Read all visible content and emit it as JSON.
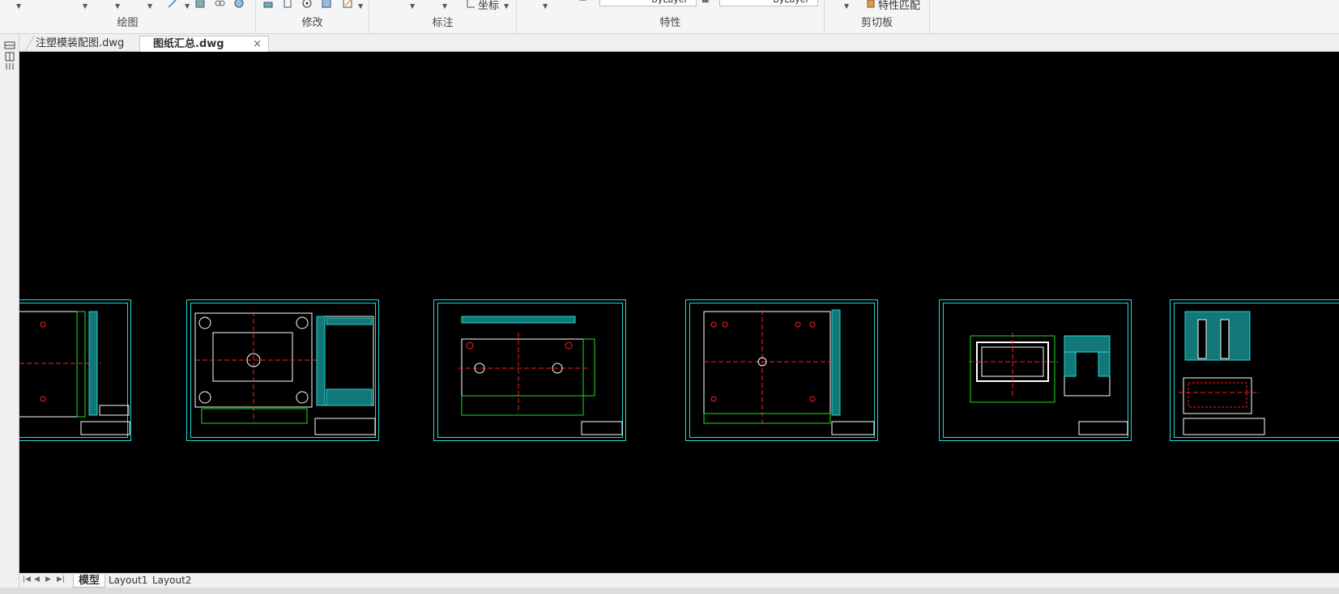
{
  "ribbon": {
    "groups": [
      {
        "label": "绘图"
      },
      {
        "label": "修改"
      },
      {
        "label": "标注"
      },
      {
        "label": "特性"
      },
      {
        "label": "剪切板"
      }
    ],
    "coordinate_label": "坐标",
    "bylayer_1": "ByLayer",
    "bylayer_2": "ByLayer",
    "match_properties": "特性匹配"
  },
  "tabs": {
    "inactive": "注塑模装配图.dwg",
    "active": "图纸汇总.dwg",
    "close": "×"
  },
  "layout_tabs": [
    "模型",
    "Layout1",
    "Layout2"
  ],
  "colors": {
    "canvas_bg": "#000000",
    "frame": "#29d6d6",
    "centerline": "#ff2020",
    "outline": "#ffffff",
    "dim": "#22dd22",
    "text": "#ffff00"
  },
  "icons": [
    "line-icon",
    "rectangle-icon",
    "region-icon",
    "circle-icon",
    "stretch-icon",
    "copy-icon",
    "edit-icon",
    "match-properties-icon"
  ]
}
